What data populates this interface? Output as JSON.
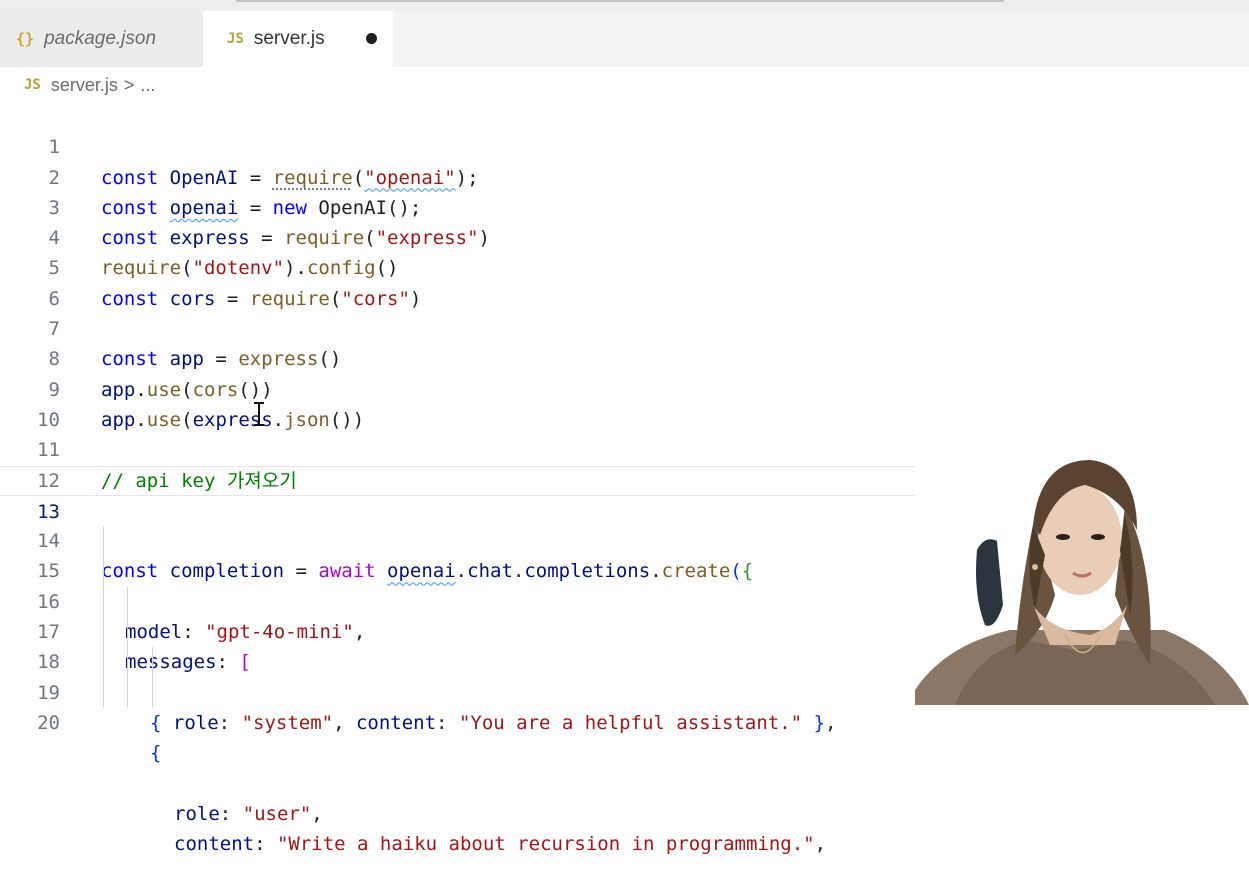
{
  "tabs": [
    {
      "icon": "{}",
      "label": "package.json",
      "active": false
    },
    {
      "icon": "JS",
      "label": "server.js",
      "active": true,
      "unsaved": true
    }
  ],
  "breadcrumb": {
    "icon": "JS",
    "file": "server.js",
    "separator": ">",
    "rest": "..."
  },
  "editor": {
    "current_line": 13,
    "lines": [
      {
        "n": "1"
      },
      {
        "n": "2"
      },
      {
        "n": "3"
      },
      {
        "n": "4"
      },
      {
        "n": "5"
      },
      {
        "n": "6"
      },
      {
        "n": "7"
      },
      {
        "n": "8"
      },
      {
        "n": "9"
      },
      {
        "n": "10"
      },
      {
        "n": "11"
      },
      {
        "n": "12"
      },
      {
        "n": "13"
      },
      {
        "n": "14"
      },
      {
        "n": "15"
      },
      {
        "n": "16"
      },
      {
        "n": "17"
      },
      {
        "n": "18"
      },
      {
        "n": "19"
      },
      {
        "n": "20"
      }
    ],
    "tokens": {
      "l1": [
        "const",
        " ",
        "OpenAI",
        " = ",
        "require",
        "(",
        "\"openai\"",
        ");"
      ],
      "l2": [
        "const",
        " ",
        "openai",
        " = ",
        "new",
        " ",
        "OpenAI",
        "();"
      ],
      "l3": [
        "const",
        " ",
        "express",
        " = ",
        "require",
        "(",
        "\"express\"",
        ")"
      ],
      "l4": [
        "require",
        "(",
        "\"dotenv\"",
        ").",
        "config",
        "()"
      ],
      "l5": [
        "const",
        " ",
        "cors",
        " = ",
        "require",
        "(",
        "\"cors\"",
        ")"
      ],
      "l7": [
        "const",
        " ",
        "app",
        " = ",
        "express",
        "()"
      ],
      "l8": [
        "app",
        ".",
        "use",
        "(",
        "cors",
        "())"
      ],
      "l9": [
        "app",
        ".",
        "use",
        "(",
        "express",
        ".",
        "json",
        "())"
      ],
      "l11": "// api key 가져오기",
      "l14": [
        "const",
        " ",
        "completion",
        " = ",
        "await",
        " ",
        "openai",
        ".",
        "chat",
        ".",
        "completions",
        ".",
        "create",
        "(",
        "{"
      ],
      "l15": [
        "model",
        ": ",
        "\"gpt-4o-mini\"",
        ","
      ],
      "l16": [
        "messages",
        ": ",
        "["
      ],
      "l17": [
        "{",
        " ",
        "role",
        ": ",
        "\"system\"",
        ", ",
        "content",
        ": ",
        "\"You are a helpful assistant.\"",
        " ",
        "}",
        ","
      ],
      "l18": [
        "{"
      ],
      "l19": [
        "role",
        ": ",
        "\"user\"",
        ","
      ],
      "l20": [
        "content",
        ": ",
        "\"Write a haiku about recursion in programming.\"",
        ","
      ]
    }
  },
  "colors": {
    "keyword": "#0000ff",
    "variable": "#001080",
    "function": "#795e26",
    "string": "#a31515",
    "comment": "#008000",
    "control": "#af00db"
  }
}
